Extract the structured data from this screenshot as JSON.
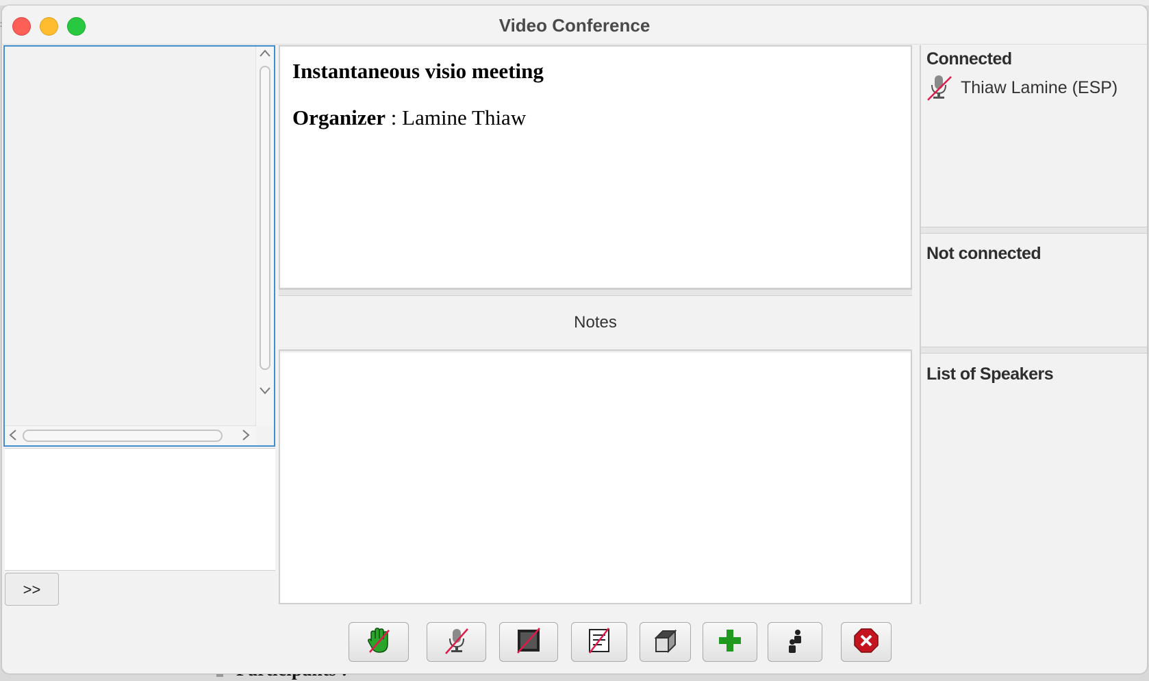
{
  "window": {
    "title": "Video Conference"
  },
  "meeting": {
    "title": "Instantaneous visio meeting",
    "organizer_label": "Organizer",
    "organizer_separator": " : ",
    "organizer_name": "Lamine Thiaw"
  },
  "notes": {
    "label": "Notes",
    "content": ""
  },
  "left_panel": {
    "expand_label": ">>"
  },
  "participants": {
    "connected_header": "Connected",
    "connected": [
      {
        "name": "Thiaw Lamine (ESP)",
        "icon": "muted-microphone-icon"
      }
    ],
    "not_connected_header": "Not connected",
    "not_connected": [],
    "speakers_header": "List of Speakers",
    "speakers": []
  },
  "toolbar": {
    "buttons": [
      {
        "icon": "raise-hand-icon",
        "accent": "#2aa52a"
      },
      {
        "icon": "mute-microphone-icon",
        "accent": "#e0194b"
      },
      {
        "icon": "disable-video-icon",
        "accent": "#e0194b"
      },
      {
        "icon": "disable-notes-icon",
        "accent": "#e0194b"
      },
      {
        "icon": "box-icon",
        "accent": "#333333"
      },
      {
        "icon": "add-icon",
        "accent": "#1f9a1f"
      },
      {
        "icon": "participants-icon",
        "accent": "#222222"
      },
      {
        "icon": "close-icon",
        "accent": "#c4141f"
      }
    ]
  },
  "background_window": {
    "partial_text": "Participants :"
  }
}
